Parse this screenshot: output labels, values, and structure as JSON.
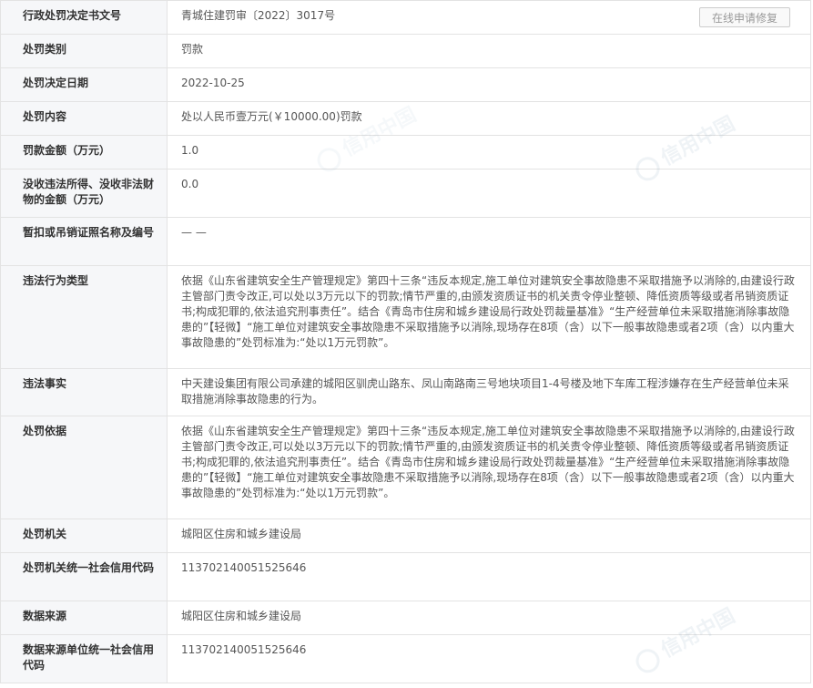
{
  "repair_button": "在线申请修复",
  "watermark_text": "信用中国",
  "rows": [
    {
      "label": "行政处罚决定书文号",
      "value": "青城住建罚审〔2022〕3017号"
    },
    {
      "label": "处罚类别",
      "value": "罚款"
    },
    {
      "label": "处罚决定日期",
      "value": "2022-10-25"
    },
    {
      "label": "处罚内容",
      "value": "处以人民币壹万元(￥10000.00)罚款"
    },
    {
      "label": "罚款金额（万元）",
      "value": "1.0"
    },
    {
      "label": "没收违法所得、没收非法财物的金额（万元）",
      "value": "0.0"
    },
    {
      "label": "暂扣或吊销证照名称及编号",
      "value": "— —"
    },
    {
      "label": "违法行为类型",
      "value": "依据《山东省建筑安全生产管理规定》第四十三条“违反本规定,施工单位对建筑安全事故隐患不采取措施予以消除的,由建设行政主管部门责令改正,可以处以3万元以下的罚款;情节严重的,由颁发资质证书的机关责令停业整顿、降低资质等级或者吊销资质证书;构成犯罪的,依法追究刑事责任”。结合《青岛市住房和城乡建设局行政处罚裁量基准》“生产经营单位未采取措施消除事故隐患的”【轻微】“施工单位对建筑安全事故隐患不采取措施予以消除,现场存在8项（含）以下一般事故隐患或者2项（含）以内重大事故隐患的”处罚标准为:“处以1万元罚款”。"
    },
    {
      "label": "违法事实",
      "value": "中天建设集团有限公司承建的城阳区驯虎山路东、凤山南路南三号地块项目1-4号楼及地下车库工程涉嫌存在生产经营单位未采取措施消除事故隐患的行为。"
    },
    {
      "label": "处罚依据",
      "value": "依据《山东省建筑安全生产管理规定》第四十三条“违反本规定,施工单位对建筑安全事故隐患不采取措施予以消除的,由建设行政主管部门责令改正,可以处以3万元以下的罚款;情节严重的,由颁发资质证书的机关责令停业整顿、降低资质等级或者吊销资质证书;构成犯罪的,依法追究刑事责任”。结合《青岛市住房和城乡建设局行政处罚裁量基准》“生产经营单位未采取措施消除事故隐患的”【轻微】“施工单位对建筑安全事故隐患不采取措施予以消除,现场存在8项（含）以下一般事故隐患或者2项（含）以内重大事故隐患的”处罚标准为:“处以1万元罚款”。"
    },
    {
      "label": "处罚机关",
      "value": "城阳区住房和城乡建设局"
    },
    {
      "label": "处罚机关统一社会信用代码",
      "value": "113702140051525646"
    },
    {
      "label": "数据来源",
      "value": "城阳区住房和城乡建设局"
    },
    {
      "label": "数据来源单位统一社会信用代码",
      "value": "113702140051525646"
    }
  ]
}
